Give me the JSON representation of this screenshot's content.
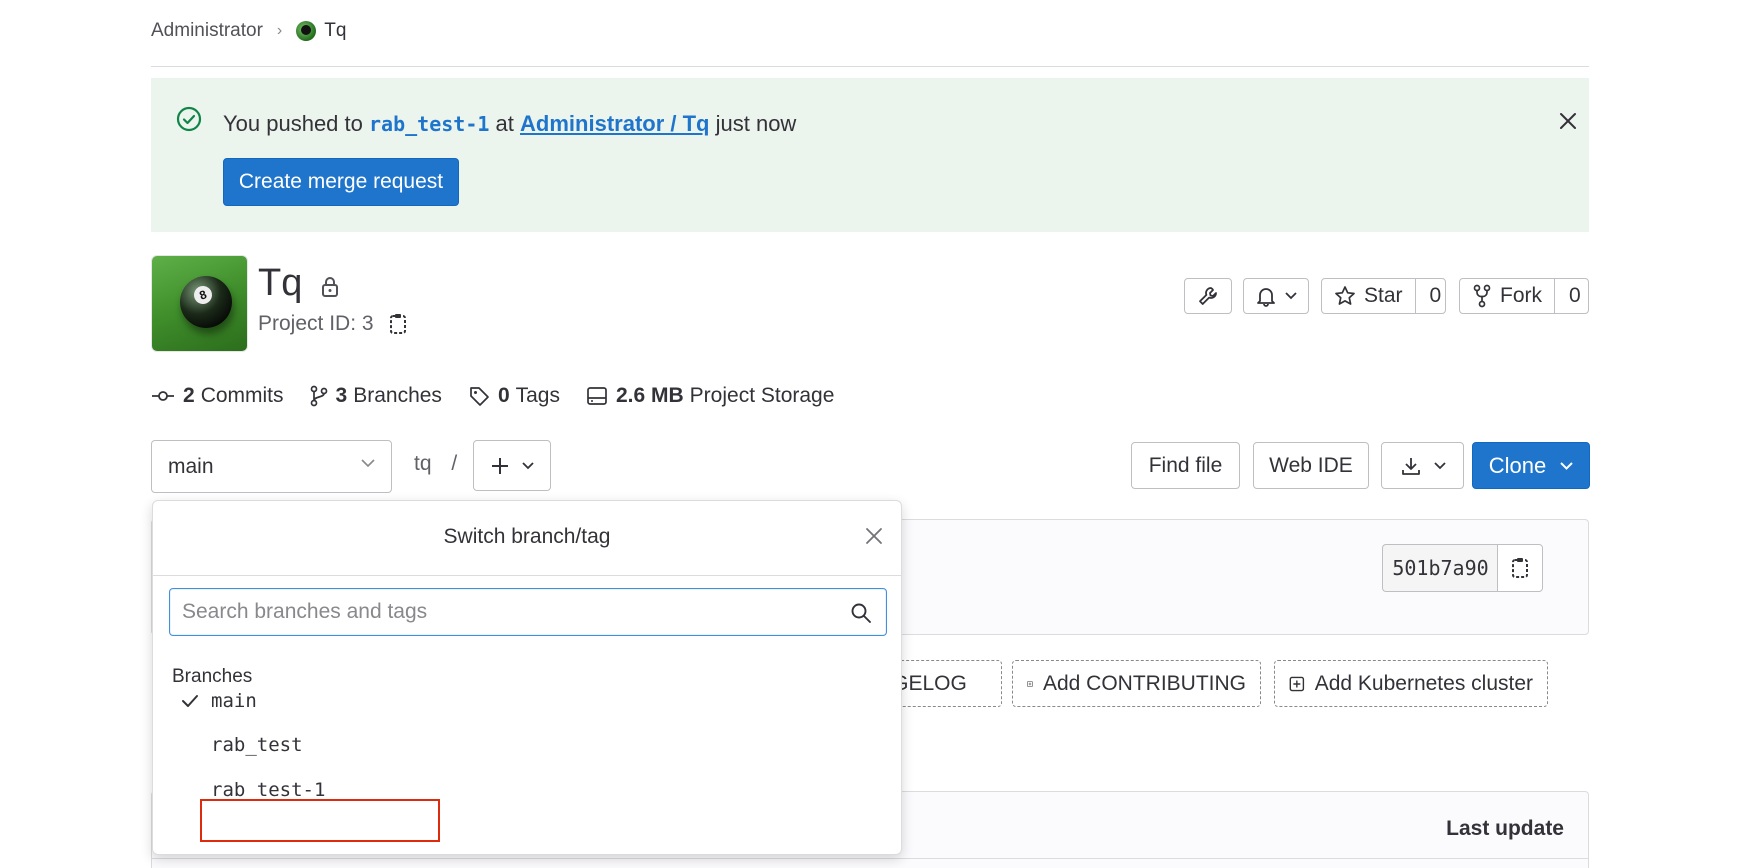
{
  "breadcrumb": {
    "parent": "Administrator",
    "current": "Tq"
  },
  "alert": {
    "prefix": "You pushed to",
    "branch": "rab_test-1",
    "at": "at",
    "project_link": "Administrator / Tq",
    "suffix": "just now",
    "button": "Create merge request"
  },
  "project": {
    "name": "Tq",
    "id_text": "Project ID: 3",
    "star_label": "Star",
    "star_count": "0",
    "fork_label": "Fork",
    "fork_count": "0"
  },
  "stats": {
    "commits_count": "2",
    "commits_label": "Commits",
    "branches_count": "3",
    "branches_label": "Branches",
    "tags_count": "0",
    "tags_label": "Tags",
    "storage_size": "2.6 MB",
    "storage_label": "Project Storage"
  },
  "tree": {
    "branch": "main",
    "path": "tq",
    "path_sep": "/",
    "find_file": "Find file",
    "web_ide": "Web IDE",
    "clone": "Clone"
  },
  "commit": {
    "sha": "501b7a90"
  },
  "quick_actions": {
    "changelog": "NGELOG",
    "contributing": "Add CONTRIBUTING",
    "kubernetes": "Add Kubernetes cluster"
  },
  "files": {
    "last_update": "Last update"
  },
  "dropdown": {
    "title": "Switch branch/tag",
    "search_placeholder": "Search branches and tags",
    "section": "Branches",
    "items": [
      {
        "label": "main",
        "selected": true
      },
      {
        "label": "rab_test",
        "selected": false
      },
      {
        "label": "rab_test-1",
        "selected": false
      }
    ]
  },
  "colors": {
    "primary": "#1f75cb",
    "success_bg": "#ecf4ee",
    "success_icon": "#108548",
    "highlight": "#dd2b0e"
  }
}
